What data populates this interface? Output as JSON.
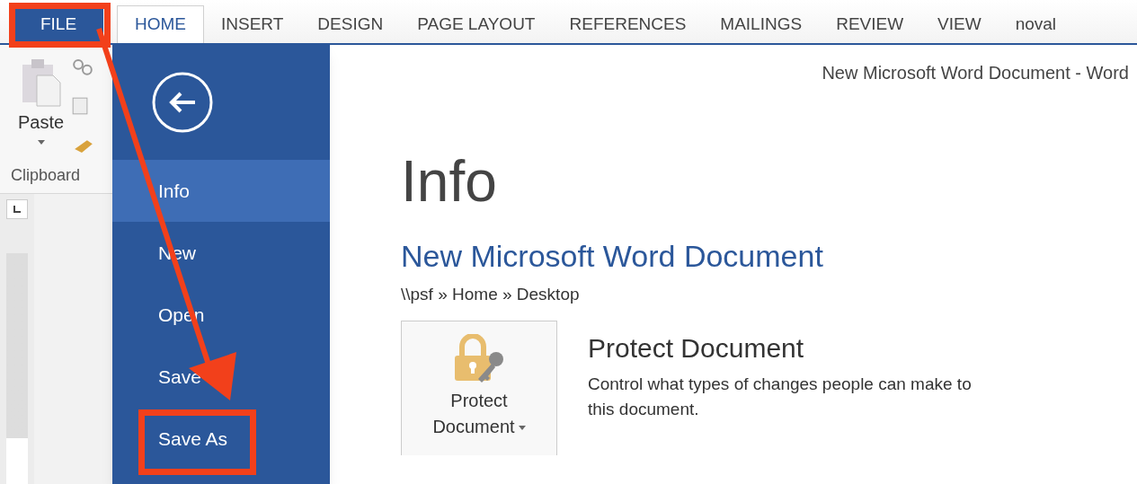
{
  "tabs": [
    {
      "label": "FILE",
      "kind": "file",
      "selected": false
    },
    {
      "label": "HOME",
      "kind": "tab",
      "selected": true
    },
    {
      "label": "INSERT",
      "kind": "tab",
      "selected": false
    },
    {
      "label": "DESIGN",
      "kind": "tab",
      "selected": false
    },
    {
      "label": "PAGE LAYOUT",
      "kind": "tab",
      "selected": false
    },
    {
      "label": "REFERENCES",
      "kind": "tab",
      "selected": false
    },
    {
      "label": "MAILINGS",
      "kind": "tab",
      "selected": false
    },
    {
      "label": "REVIEW",
      "kind": "tab",
      "selected": false
    },
    {
      "label": "VIEW",
      "kind": "tab",
      "selected": false
    },
    {
      "label": "noval",
      "kind": "tab",
      "selected": false
    }
  ],
  "ribbon": {
    "paste_label": "Paste",
    "group_label": "Clipboard"
  },
  "window": {
    "title": "New Microsoft Word Document - Word"
  },
  "backstage": {
    "items": [
      {
        "label": "Info",
        "selected": true
      },
      {
        "label": "New",
        "selected": false
      },
      {
        "label": "Open",
        "selected": false
      },
      {
        "label": "Save",
        "selected": false
      },
      {
        "label": "Save As",
        "selected": false
      }
    ]
  },
  "info": {
    "heading": "Info",
    "document_title": "New Microsoft Word Document",
    "path": "\\\\psf » Home » Desktop",
    "protect": {
      "button_label": "Protect Document",
      "heading": "Protect Document",
      "description": "Control what types of changes people can make to this document."
    }
  }
}
